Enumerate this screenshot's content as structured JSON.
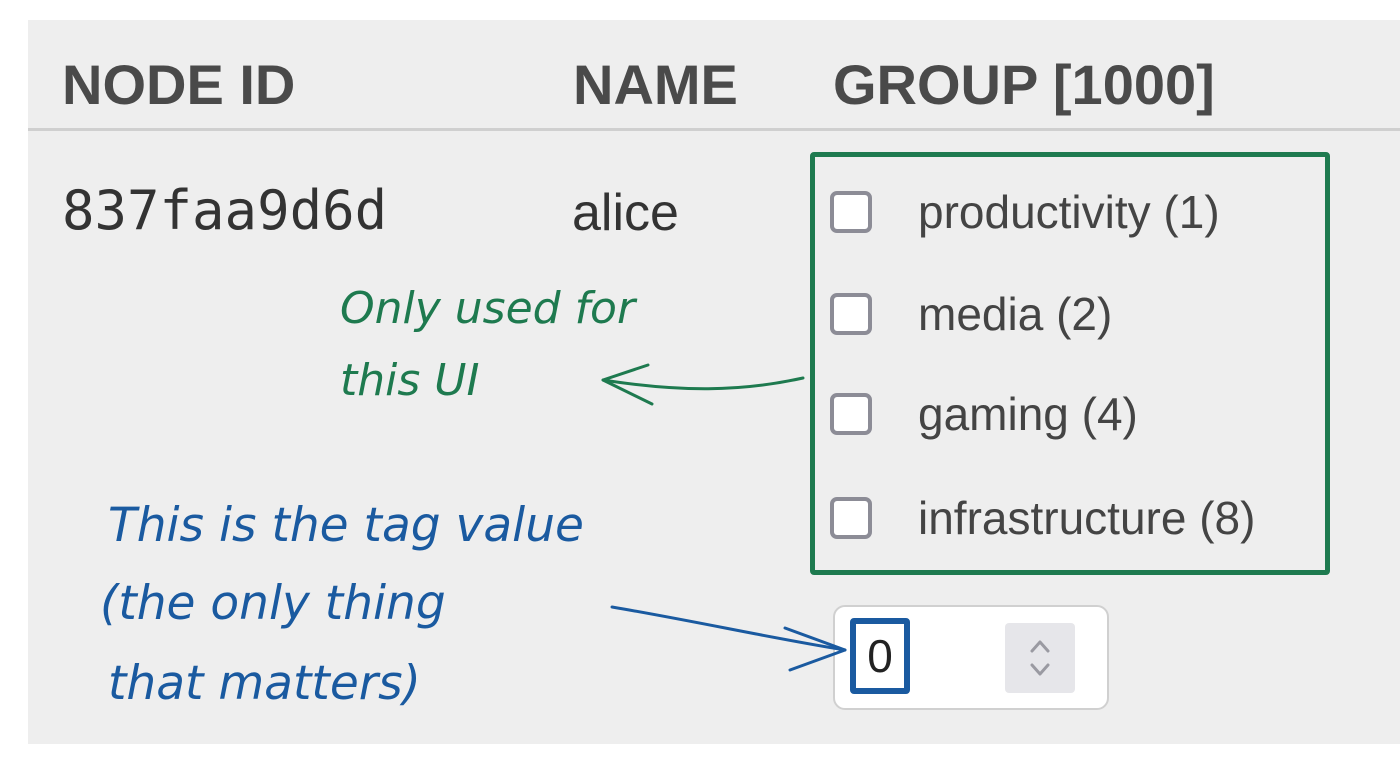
{
  "table": {
    "headers": {
      "node_id": "NODE ID",
      "name": "NAME",
      "group": "GROUP [1000]"
    },
    "row": {
      "node_id": "837faa9d6d",
      "name": "alice",
      "group_options": [
        {
          "label": "productivity (1)",
          "checked": false
        },
        {
          "label": "media (2)",
          "checked": false
        },
        {
          "label": "gaming (4)",
          "checked": false
        },
        {
          "label": "infrastructure (8)",
          "checked": false
        }
      ],
      "tag_value": "0"
    }
  },
  "annotations": {
    "green": {
      "line1": "Only used for",
      "line2": "this UI",
      "color": "#1e7a4f"
    },
    "blue": {
      "line1": "This is the tag value",
      "line2": "(the only thing",
      "line3": "that matters)",
      "color": "#1a5aa0"
    }
  },
  "icons": {
    "stepper": "up-down-chevron-icon",
    "checkbox": "checkbox-icon"
  }
}
